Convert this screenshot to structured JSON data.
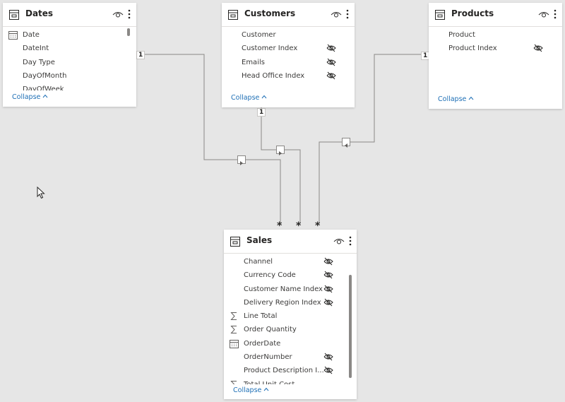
{
  "colors": {
    "canvas_bg": "#e6e6e6",
    "card_bg": "#ffffff",
    "line": "#8a8886",
    "accent_link": "#1c6eb5",
    "text": "#252423"
  },
  "tables": {
    "dates": {
      "title": "Dates",
      "collapse_label": "Collapse",
      "fields": [
        {
          "name": "Date",
          "icon": "calendar-icon",
          "hidden": false
        },
        {
          "name": "DateInt",
          "icon": "",
          "hidden": false
        },
        {
          "name": "Day Type",
          "icon": "",
          "hidden": false
        },
        {
          "name": "DayOfMonth",
          "icon": "",
          "hidden": false
        },
        {
          "name": "DayOfWeek",
          "icon": "",
          "hidden": false
        }
      ]
    },
    "customers": {
      "title": "Customers",
      "collapse_label": "Collapse",
      "fields": [
        {
          "name": "Customer",
          "icon": "",
          "hidden": false
        },
        {
          "name": "Customer Index",
          "icon": "",
          "hidden": true
        },
        {
          "name": "Emails",
          "icon": "",
          "hidden": true
        },
        {
          "name": "Head Office Index",
          "icon": "",
          "hidden": true
        }
      ]
    },
    "products": {
      "title": "Products",
      "collapse_label": "Collapse",
      "fields": [
        {
          "name": "Product",
          "icon": "",
          "hidden": false
        },
        {
          "name": "Product Index",
          "icon": "",
          "hidden": true
        }
      ]
    },
    "sales": {
      "title": "Sales",
      "collapse_label": "Collapse",
      "fields": [
        {
          "name": "Channel",
          "icon": "",
          "hidden": true
        },
        {
          "name": "Currency Code",
          "icon": "",
          "hidden": true
        },
        {
          "name": "Customer Name Index",
          "icon": "",
          "hidden": true
        },
        {
          "name": "Delivery Region Index",
          "icon": "",
          "hidden": true
        },
        {
          "name": "Line Total",
          "icon": "sigma-icon",
          "hidden": false
        },
        {
          "name": "Order Quantity",
          "icon": "sigma-icon",
          "hidden": false
        },
        {
          "name": "OrderDate",
          "icon": "calendar-icon",
          "hidden": false
        },
        {
          "name": "OrderNumber",
          "icon": "",
          "hidden": true
        },
        {
          "name": "Product Description I...",
          "icon": "",
          "hidden": true
        },
        {
          "name": "Total Unit Cost",
          "icon": "sigma-icon",
          "hidden": false
        }
      ]
    }
  },
  "relationships": {
    "one_label": "1",
    "many_label": "*"
  }
}
